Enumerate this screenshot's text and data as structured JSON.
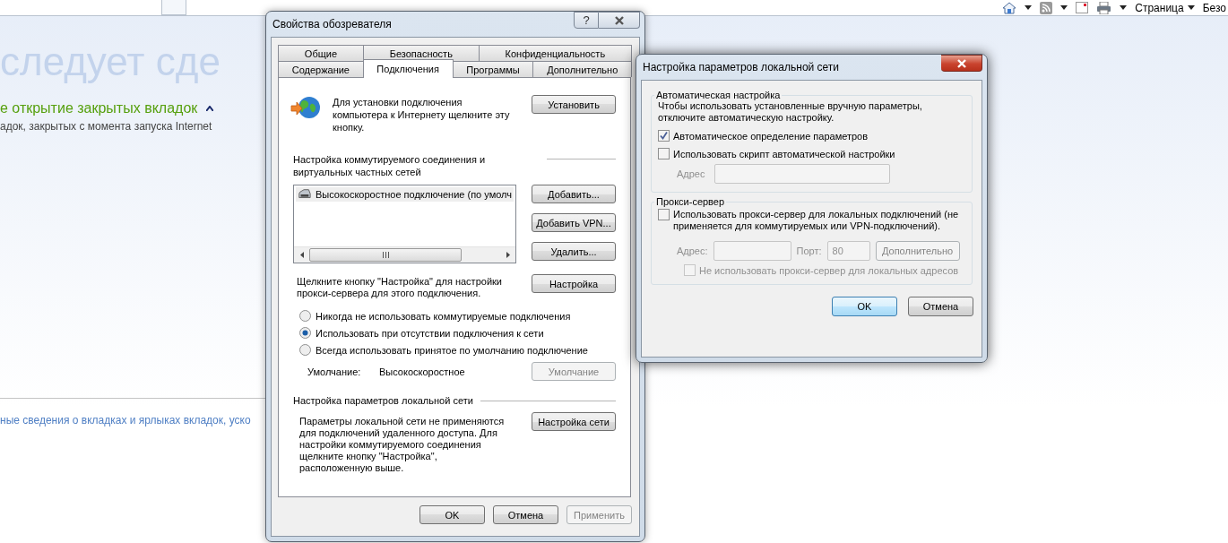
{
  "browser_toolbar": {
    "page_menu": "Страница",
    "next_menu": "Безо"
  },
  "page": {
    "heading": "следует сде",
    "section_title": "е открытие закрытых вкладок",
    "section_text": "адок, закрытых с момента запуска Internet",
    "link": "ные сведения о вкладках и ярлыках вкладок, уско"
  },
  "internet_options": {
    "title": "Свойства обозревателя",
    "help_button": "?",
    "tab_rows": [
      [
        {
          "label": "Общие",
          "selected": false
        },
        {
          "label": "Безопасность",
          "selected": false
        },
        {
          "label": "Конфиденциальность",
          "selected": false
        }
      ],
      [
        {
          "label": "Содержание",
          "selected": false
        },
        {
          "label": "Подключения",
          "selected": true
        },
        {
          "label": "Программы",
          "selected": false
        },
        {
          "label": "Дополнительно",
          "selected": false
        }
      ]
    ],
    "setup": {
      "text": "Для установки подключения компьютера к Интернету щелкните эту кнопку.",
      "button": "Установить"
    },
    "dialup": {
      "heading": "Настройка коммутируемого соединения и виртуальных частных сетей",
      "connections": [
        {
          "name": "Высокоскоростное подключение (по умолч",
          "selected": true
        }
      ],
      "buttons": [
        "Добавить...",
        "Добавить VPN...",
        "Удалить..."
      ]
    },
    "proxy_note": {
      "text": "Щелкните кнопку \"Настройка\" для настройки прокси-сервера для этого подключения.",
      "button": "Настройка"
    },
    "dial_options": [
      {
        "label": "Никогда не использовать коммутируемые подключения",
        "selected": false
      },
      {
        "label": "Использовать при отсутствии подключения к сети",
        "selected": true
      },
      {
        "label": "Всегда использовать принятое по умолчанию подключение",
        "selected": false
      }
    ],
    "default": {
      "label": "Умолчание:",
      "value": "Высокоскоростное",
      "button": "Умолчание",
      "button_disabled": true
    },
    "lan": {
      "heading": "Настройка параметров локальной сети",
      "text": "Параметры локальной сети не применяются для подключений удаленного доступа. Для настройки коммутируемого соединения щелкните кнопку \"Настройка\", расположенную выше.",
      "button": "Настройка сети"
    },
    "footer_buttons": [
      {
        "label": "OK",
        "disabled": false
      },
      {
        "label": "Отмена",
        "disabled": false
      },
      {
        "label": "Применить",
        "disabled": true
      }
    ]
  },
  "lan_settings": {
    "title": "Настройка параметров локальной сети",
    "auto": {
      "legend": "Автоматическая настройка",
      "note": "Чтобы использовать установленные вручную параметры, отключите автоматическую настройку.",
      "options": [
        {
          "label": "Автоматическое определение параметров",
          "checked": true
        },
        {
          "label": "Использовать скрипт автоматической настройки",
          "checked": false
        }
      ],
      "address_label": "Адрес",
      "address_disabled": true
    },
    "proxy": {
      "legend": "Прокси-сервер",
      "use": {
        "label": "Использовать прокси-сервер для локальных подключений (не применяется для коммутируемых или VPN-подключений).",
        "checked": false
      },
      "address_label": "Адрес:",
      "port_label": "Порт:",
      "port_value": "80",
      "advanced_button": "Дополнительно",
      "disabled": true,
      "bypass": {
        "label": "Не использовать прокси-сервер для локальных адресов",
        "checked": false
      }
    },
    "buttons": [
      {
        "label": "OK",
        "default": true
      },
      {
        "label": "Отмена",
        "default": false
      }
    ]
  }
}
